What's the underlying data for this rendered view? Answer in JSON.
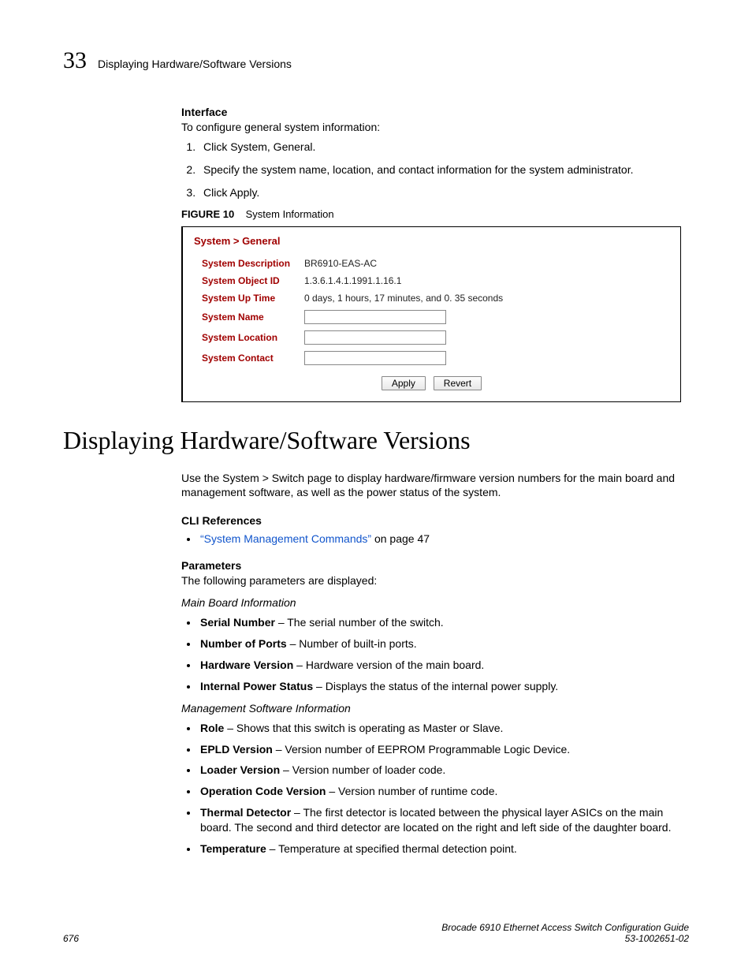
{
  "header": {
    "chapter_number": "33",
    "running_title": "Displaying Hardware/Software Versions"
  },
  "interface": {
    "heading": "Interface",
    "intro": "To configure general system information:",
    "steps": [
      "Click System, General.",
      "Specify the system name, location, and contact information for the system administrator.",
      "Click Apply."
    ]
  },
  "figure": {
    "label": "FIGURE 10",
    "title": "System Information",
    "breadcrumb": "System > General",
    "rows": {
      "desc_label": "System Description",
      "desc_value": "BR6910-EAS-AC",
      "oid_label": "System Object ID",
      "oid_value": "1.3.6.1.4.1.1991.1.16.1",
      "uptime_label": "System Up Time",
      "uptime_value": "0 days, 1 hours, 17 minutes, and 0. 35 seconds",
      "name_label": "System Name",
      "location_label": "System Location",
      "contact_label": "System Contact"
    },
    "buttons": {
      "apply": "Apply",
      "revert": "Revert"
    }
  },
  "section": {
    "title": "Displaying Hardware/Software Versions",
    "intro": "Use the System > Switch page to display hardware/firmware version numbers for the main board and management software, as well as the power status of the system.",
    "cli_heading": "CLI References",
    "cli_link": "“System Management Commands”",
    "cli_suffix": " on page 47",
    "params_heading": "Parameters",
    "params_intro": "The following parameters are displayed:",
    "group1_title": "Main Board Information",
    "group1": [
      {
        "term": "Serial Number",
        "desc": " – The serial number of the switch."
      },
      {
        "term": "Number of Ports",
        "desc": " – Number of built-in ports."
      },
      {
        "term": "Hardware Version",
        "desc": " – Hardware version of the main board."
      },
      {
        "term": "Internal Power Status",
        "desc": " – Displays the status of the internal power supply."
      }
    ],
    "group2_title": "Management Software Information",
    "group2": [
      {
        "term": "Role",
        "desc": " – Shows that this switch is operating as Master or Slave."
      },
      {
        "term": "EPLD Version",
        "desc": " – Version number of EEPROM Programmable Logic Device."
      },
      {
        "term": "Loader Version",
        "desc": " – Version number of loader code."
      },
      {
        "term": "Operation Code Version",
        "desc": " – Version number of runtime code."
      },
      {
        "term": "Thermal Detector",
        "desc": " – The first detector is located between the physical layer ASICs on the main board. The second and third detector are located on the right and left side of the daughter board."
      },
      {
        "term": "Temperature",
        "desc": " – Temperature at specified thermal detection point."
      }
    ]
  },
  "footer": {
    "page": "676",
    "doc_title": "Brocade 6910 Ethernet Access Switch Configuration Guide",
    "doc_num": "53-1002651-02"
  }
}
